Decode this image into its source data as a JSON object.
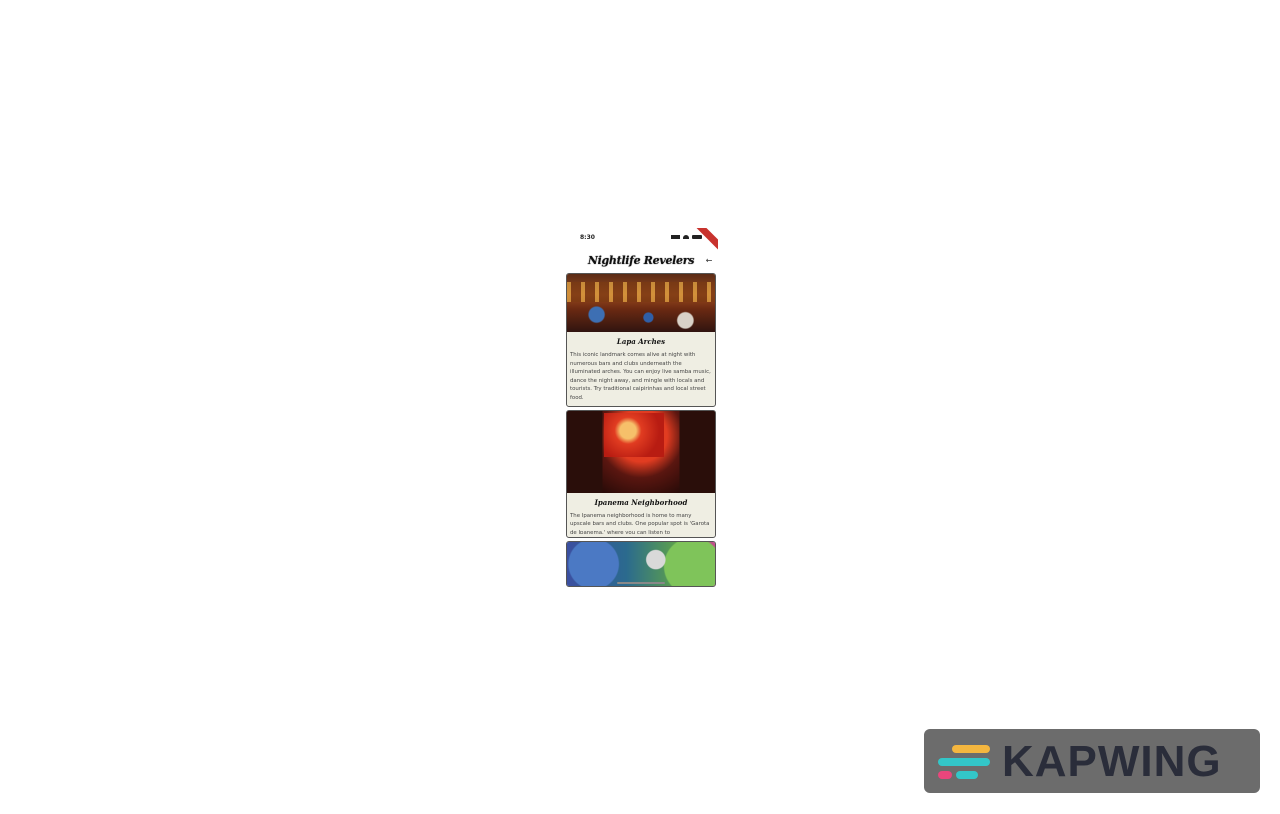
{
  "status_bar": {
    "time": "8:30"
  },
  "header": {
    "title": "Nightlife Revelers"
  },
  "cards": [
    {
      "title": "Lapa Arches",
      "description": "This iconic landmark comes alive at night with numerous bars and clubs underneath the illuminated arches. You can enjoy live samba music, dance the night away, and mingle with locals and tourists. Try traditional caipirinhas and local street food."
    },
    {
      "title": "Ipanema Neighborhood",
      "description": "The Ipanema neighborhood is home to many upscale bars and clubs. One popular spot is 'Garota de Ipanema,' where you can listen to"
    }
  ],
  "watermark": {
    "text": "KAPWING"
  },
  "colors": {
    "debug_ribbon": "#c8332e",
    "card_background": "#efeee3",
    "watermark_background": "#6c6c6c",
    "logo_yellow": "#f4b63f",
    "logo_teal": "#33c6c8",
    "logo_pink": "#e8467c"
  }
}
